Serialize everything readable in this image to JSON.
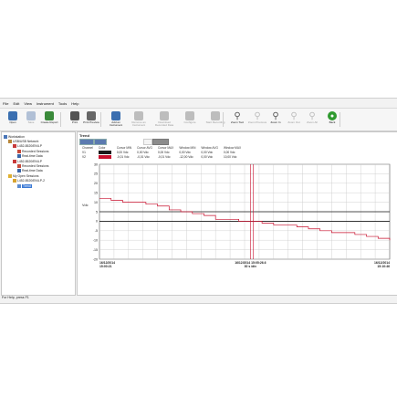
{
  "menu": [
    "File",
    "Edit",
    "View",
    "Instrument",
    "Tools",
    "Help"
  ],
  "toolbar": [
    {
      "label": "Open",
      "icon": "folder-icon",
      "color": "#3a6fb0",
      "disabled": false
    },
    {
      "label": "Save",
      "icon": "save-icon",
      "color": "#5d7fb0",
      "disabled": true
    },
    {
      "label": "Create Report",
      "icon": "report-icon",
      "color": "#3a8a3a",
      "disabled": false
    },
    {
      "label": "Print",
      "icon": "print-icon",
      "color": "#555555",
      "disabled": false
    },
    {
      "label": "Print Preview",
      "icon": "print-preview-icon",
      "color": "#666666",
      "disabled": false
    },
    {
      "label": "Add an Instrument",
      "icon": "add-instrument-icon",
      "color": "#3a6fb0",
      "disabled": false
    },
    {
      "label": "Remove an Instrument",
      "icon": "remove-instrument-icon",
      "color": "#777777",
      "disabled": true
    },
    {
      "label": "Download Recorded Data",
      "icon": "download-icon",
      "color": "#777777",
      "disabled": true
    },
    {
      "label": "Configure",
      "icon": "configure-icon",
      "color": "#777777",
      "disabled": true
    },
    {
      "label": "Start Recording",
      "icon": "record-icon",
      "color": "#777777",
      "disabled": true
    },
    {
      "label": "Zoom Tool",
      "icon": "zoom-tool-icon",
      "color": "#555555",
      "disabled": false
    },
    {
      "label": "Zoom Previous",
      "icon": "zoom-previous-icon",
      "color": "#777777",
      "disabled": true
    },
    {
      "label": "Zoom In",
      "icon": "zoom-in-icon",
      "color": "#555555",
      "disabled": false
    },
    {
      "label": "Zoom Out",
      "icon": "zoom-out-icon",
      "color": "#777777",
      "disabled": true
    },
    {
      "label": "Zoom All",
      "icon": "zoom-all-icon",
      "color": "#777777",
      "disabled": true
    },
    {
      "label": "Back",
      "icon": "back-icon",
      "color": "#2f9a2f",
      "disabled": false
    }
  ],
  "tree": [
    {
      "label": "Workstation",
      "indent": 0,
      "icon": "workstation-icon",
      "selected": false
    },
    {
      "label": "USB/USB Network",
      "indent": 1,
      "icon": "network-icon",
      "selected": false
    },
    {
      "label": "L452-8520/EN/LP",
      "indent": 2,
      "icon": "instrument-icon",
      "selected": false
    },
    {
      "label": "Recorded Sessions",
      "indent": 3,
      "icon": "recorded-sessions-icon",
      "selected": false
    },
    {
      "label": "Real-time Data",
      "indent": 3,
      "icon": "realtime-data-icon",
      "selected": false
    },
    {
      "label": "L452-8520/EN/LP",
      "indent": 2,
      "icon": "instrument-icon",
      "selected": false
    },
    {
      "label": "Recorded Sessions",
      "indent": 3,
      "icon": "recorded-sessions-icon",
      "selected": false
    },
    {
      "label": "Real-time Data",
      "indent": 3,
      "icon": "realtime-data-icon",
      "selected": false
    },
    {
      "label": "My Open Sessions",
      "indent": 1,
      "icon": "open-sessions-icon",
      "selected": false
    },
    {
      "label": "L452-8520/EN/LP-2",
      "indent": 2,
      "icon": "session-icon",
      "selected": false
    },
    {
      "label": "Trend",
      "indent": 3,
      "icon": "trend-icon",
      "selected": true
    }
  ],
  "panel": {
    "title": "Trend"
  },
  "values_table": {
    "headers": [
      "Channel",
      "Color",
      "Cursor MIN",
      "Cursor AVG",
      "Cursor MAX",
      "Window MIN",
      "Window AVG",
      "Window MAX"
    ],
    "rows": [
      {
        "channel": "V1",
        "color": "#1a1a1a",
        "cells": [
          "0,00 Vdc",
          "0,00 Vdc",
          "0,00 Vdc",
          "0,00 Vdc",
          "0,00 Vdc",
          "0,00 Vdc"
        ]
      },
      {
        "channel": "V2",
        "color": "#c8102e",
        "cells": [
          "-0,01 Vdc",
          "-0,01 Vdc",
          "-0,01 Vdc",
          "-12,00 Vdc",
          "0,00 Vdc",
          "10,00 Vdc"
        ]
      }
    ]
  },
  "status_text": "For Help, press F1",
  "chart_data": {
    "type": "line",
    "ylabel": "Vdc",
    "ylim": [
      -20,
      30
    ],
    "yticks": [
      30,
      25,
      20,
      15,
      10,
      5,
      0,
      -5,
      -10,
      -15,
      -20
    ],
    "grid": true,
    "x_ticks": [
      {
        "date": "16/12/2014",
        "time": "15:00:21"
      },
      {
        "date": "16/12/2014 15:05:26.6",
        "time": "30 s /div"
      },
      {
        "date": "16/12/2014",
        "time": "15:10:46"
      }
    ],
    "series": [
      {
        "color": "#1a1a1a",
        "x": [
          0,
          100
        ],
        "y": [
          0,
          0
        ]
      },
      {
        "color": "#c8102e",
        "x": [
          0,
          4,
          8,
          12,
          16,
          20,
          24,
          28,
          32,
          36,
          40,
          44,
          48,
          52,
          56,
          60,
          64,
          68,
          72,
          76,
          80,
          84,
          88,
          92,
          96,
          100
        ],
        "y": [
          12,
          11,
          10,
          10,
          9,
          8,
          6,
          5,
          4,
          3,
          1,
          1,
          0,
          0,
          -1,
          -2,
          -2,
          -3,
          -4,
          -5,
          -6,
          -6,
          -7,
          -8,
          -9,
          -10
        ]
      }
    ],
    "cursor_lines": [
      {
        "color": "#c8102e",
        "x": 52
      },
      {
        "color": "#c8102e",
        "x": 53
      }
    ],
    "reference_line": {
      "color": "#1a1a1a",
      "y": 5
    }
  }
}
